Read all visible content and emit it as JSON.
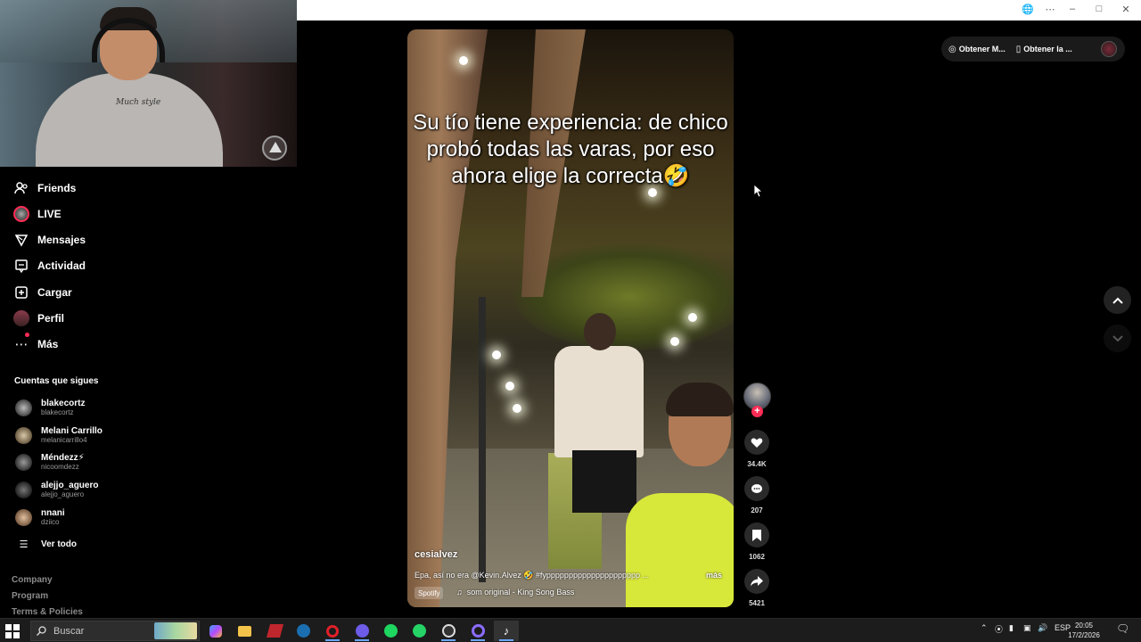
{
  "sidebar": {
    "items": [
      {
        "label": "Friends",
        "icon": "friends-icon"
      },
      {
        "label": "LIVE",
        "icon": "live-avatar"
      },
      {
        "label": "Mensajes",
        "icon": "messages-icon"
      },
      {
        "label": "Actividad",
        "icon": "activity-icon"
      },
      {
        "label": "Cargar",
        "icon": "upload-icon"
      },
      {
        "label": "Perfil",
        "icon": "profile-avatar"
      },
      {
        "label": "Más",
        "icon": "more-icon"
      }
    ],
    "following_title": "Cuentas que sigues",
    "accounts": [
      {
        "name": "blakecortz",
        "handle": "blakecortz"
      },
      {
        "name": "Melani Carrillo",
        "handle": "melanicarrillo4"
      },
      {
        "name": "Méndezz⚡",
        "handle": "nicoomdezz"
      },
      {
        "name": "alejjo_aguero",
        "handle": "alejjo_aguero"
      },
      {
        "name": "nnani",
        "handle": "dziico"
      }
    ],
    "see_all": "Ver todo",
    "footer": [
      "Company",
      "Program",
      "Terms & Policies"
    ]
  },
  "webcam": {
    "shirt_text": "Much style"
  },
  "video": {
    "caption": "Su tío tiene experiencia: de chico probó todas las varas, por eso ahora elige la correcta🤣",
    "author": "cesialvez",
    "description": "Epa, así no era @Kevin.Alvez 🤣 #fyppppppppppppppppppppp ...",
    "more": "más",
    "spotify_tag": "Spotify",
    "sound": "som original - King Song Bass"
  },
  "actions": {
    "likes": "34.4K",
    "comments": "207",
    "saves": "1062",
    "shares": "5421"
  },
  "top_pill": {
    "item1": "Obtener M...",
    "item2": "Obtener la ..."
  },
  "taskbar": {
    "search_placeholder": "Buscar",
    "lang": "ESP",
    "time": "20:05",
    "date": "17/2/2026"
  },
  "colors": {
    "accent": "#fe2c55",
    "background": "#000000"
  }
}
